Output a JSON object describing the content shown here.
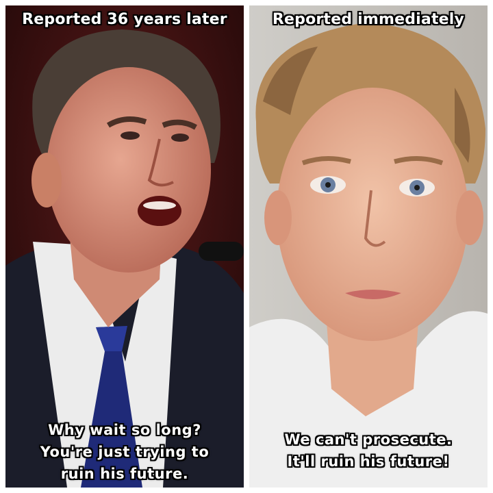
{
  "meme": {
    "left_panel": {
      "caption_top": "Reported 36 years later",
      "caption_bottom_lines": [
        "Why wait so long?",
        "You're just trying to",
        "ruin his future."
      ],
      "photo": "man-in-suit-speaking-photo"
    },
    "right_panel": {
      "caption_top": "Reported immediately",
      "caption_bottom_lines": [
        "We can't prosecute.",
        "It'll ruin his future!"
      ],
      "photo": "young-man-mugshot-photo"
    }
  },
  "colors": {
    "border": "#ffffff",
    "caption_text": "#ffffff",
    "caption_outline": "#000000"
  }
}
